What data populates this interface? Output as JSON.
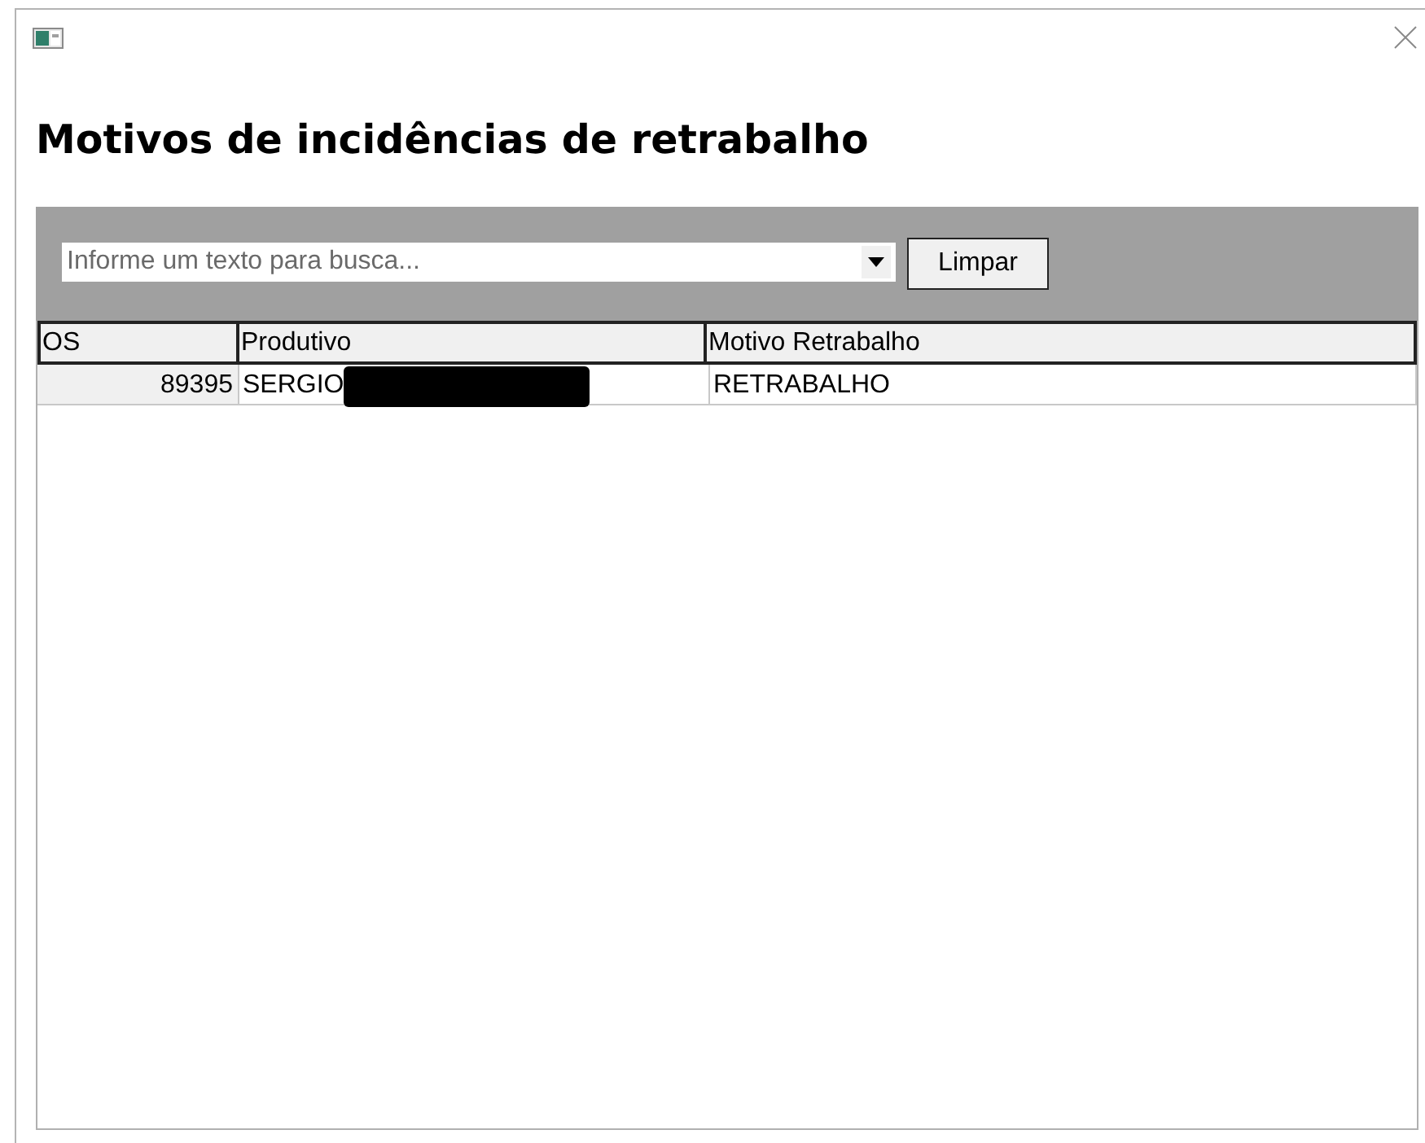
{
  "window": {
    "heading": "Motivos de incidências de retrabalho"
  },
  "search": {
    "placeholder": "Informe um texto para busca..."
  },
  "buttons": [
    {
      "label": "Limpar"
    }
  ],
  "table": {
    "columns": [
      {
        "label": "OS",
        "kind": "number"
      },
      {
        "label": "Produtivo",
        "kind": "text"
      },
      {
        "label": "Motivo Retrabalho",
        "kind": "text"
      }
    ],
    "rows": [
      {
        "cells": [
          {
            "text": "89395",
            "redacted": false
          },
          {
            "text": "SERGIO",
            "redacted": true
          },
          {
            "text": "RETRABALHO",
            "redacted": false
          }
        ]
      }
    ]
  }
}
